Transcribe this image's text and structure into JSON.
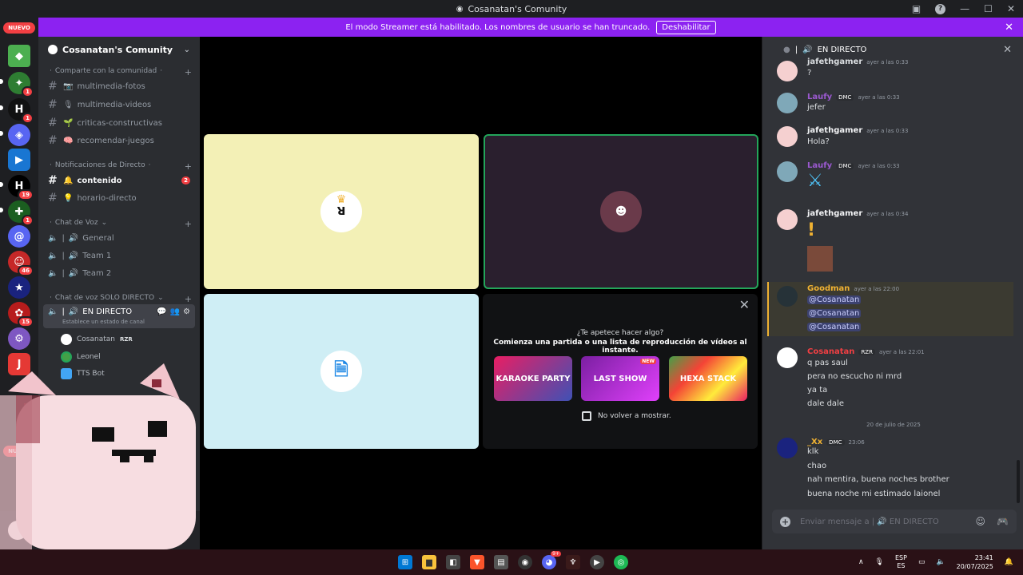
{
  "window": {
    "title": "Cosanatan's Comunity"
  },
  "banner": {
    "text": "El modo Streamer está habilitado. Los nombres de usuario se han truncado.",
    "button": "Deshabilitar"
  },
  "servers": {
    "nuevo_top": "NUEVO",
    "nuevo_bottom": "NUEVO",
    "badges": [
      "1",
      "1",
      "19",
      "1",
      "46",
      "15"
    ]
  },
  "guild": {
    "name": "Cosanatan's Comunity"
  },
  "categories": {
    "comparte": "Comparte con la comunidad",
    "notificaciones": "Notificaciones de Directo",
    "voz": "Chat de Voz",
    "solo": "Chat de voz SOLO DIRECTO"
  },
  "channels": {
    "multimedia_fotos": "multimedia-fotos",
    "multimedia_videos": "multimedia-videos",
    "criticas": "criticas-constructivas",
    "recomendar": "recomendar-juegos",
    "contenido": "contenido",
    "contenido_badge": "2",
    "horario": "horario-directo",
    "general": "General",
    "team1": "Team 1",
    "team2": "Team 2",
    "en_directo": "EN DIRECTO",
    "en_directo_status": "Establece un estado de canal"
  },
  "voice_users": [
    {
      "name": "Cosanatan",
      "tag": "RZR"
    },
    {
      "name": "Leonel"
    },
    {
      "name": "TTS Bot"
    }
  ],
  "activity": {
    "question": "¿Te apetece hacer algo?",
    "subtitle": "Comienza una partida o una lista de reproducción de vídeos al instante.",
    "games": [
      "KARAOKE PARTY",
      "LAST SHOW",
      "HEXA STACK"
    ],
    "new_tag": "NEW",
    "checkbox": "No volver a mostrar."
  },
  "chat": {
    "header": "EN DIRECTO",
    "messages": [
      {
        "name": "jafethgamer",
        "time": "ayer a las 0:33",
        "lines": [
          "?"
        ]
      },
      {
        "name": "Laufy",
        "role": "DMC",
        "time": "ayer a las 0:33",
        "lines": [
          "jefer"
        ]
      },
      {
        "name": "jafethgamer",
        "time": "ayer a las 0:33",
        "lines": [
          "Hola?"
        ]
      },
      {
        "name": "Laufy",
        "role": "DMC",
        "time": "ayer a las 0:33",
        "lines": []
      },
      {
        "name": "jafethgamer",
        "time": "ayer a las 0:34",
        "lines": []
      },
      {
        "name": "Goodman",
        "time": "ayer a las 22:00",
        "lines": [
          "@Cosanatan",
          "@Cosanatan",
          "@Cosanatan"
        ]
      },
      {
        "name": "Cosanatan",
        "role": "RZR",
        "time": "ayer a las 22:01",
        "lines": [
          "q pas saul",
          "pera no escucho ni mrd",
          "ya ta",
          "dale dale"
        ]
      },
      {
        "name": "_Xx",
        "role": "DMC",
        "time": "23:06",
        "lines": [
          "klk",
          "chao",
          "nah mentira, buena noches brother",
          "buena noche mi estimado laionel"
        ]
      }
    ],
    "date_divider": "20 de julio de 2025",
    "input_placeholder": "Enviar mensaje a | 🔊 EN DIRECTO"
  },
  "taskbar": {
    "lang1": "ESP",
    "lang2": "ES",
    "time": "23:41",
    "date": "20/07/2025",
    "discord_badge": "9+"
  },
  "colors": {
    "accent": "#8c22f1",
    "mention": "#c9cdfb",
    "cosanatan_name": "#f23f43",
    "goodman_name": "#f0b232",
    "laufy_name": "#9b59d0"
  }
}
